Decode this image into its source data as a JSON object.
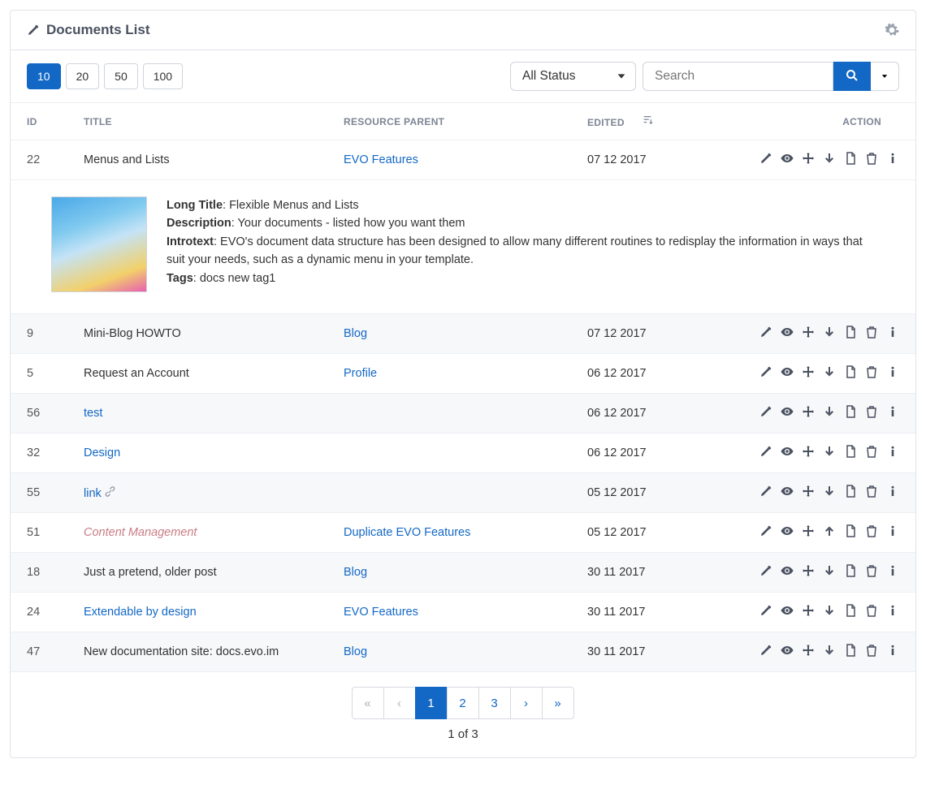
{
  "header": {
    "title": "Documents List"
  },
  "toolbar": {
    "page_sizes": [
      "10",
      "20",
      "50",
      "100"
    ],
    "active_size": "10",
    "status_label": "All Status",
    "search_placeholder": "Search"
  },
  "columns": {
    "id": "ID",
    "title": "TITLE",
    "parent": "RESOURCE PARENT",
    "edited": "EDITED",
    "action": "ACTION"
  },
  "rows": [
    {
      "id": "22",
      "title": "Menus and Lists",
      "title_link": false,
      "italic": false,
      "parent": "EVO Features",
      "parent_link": true,
      "edited": "07 12 2017",
      "arrow": "down",
      "chain": false,
      "expanded": true
    },
    {
      "id": "9",
      "title": "Mini-Blog HOWTO",
      "title_link": false,
      "italic": false,
      "parent": "Blog",
      "parent_link": true,
      "edited": "07 12 2017",
      "arrow": "down",
      "chain": false
    },
    {
      "id": "5",
      "title": "Request an Account",
      "title_link": false,
      "italic": false,
      "parent": "Profile",
      "parent_link": true,
      "edited": "06 12 2017",
      "arrow": "down",
      "chain": false
    },
    {
      "id": "56",
      "title": "test",
      "title_link": true,
      "italic": false,
      "parent": "",
      "parent_link": false,
      "edited": "06 12 2017",
      "arrow": "down",
      "chain": false
    },
    {
      "id": "32",
      "title": "Design",
      "title_link": true,
      "italic": false,
      "parent": "",
      "parent_link": false,
      "edited": "06 12 2017",
      "arrow": "down",
      "chain": false
    },
    {
      "id": "55",
      "title": "link",
      "title_link": true,
      "italic": false,
      "parent": "",
      "parent_link": false,
      "edited": "05 12 2017",
      "arrow": "down",
      "chain": true
    },
    {
      "id": "51",
      "title": "Content Management",
      "title_link": false,
      "italic": true,
      "parent": "Duplicate EVO Features",
      "parent_link": true,
      "edited": "05 12 2017",
      "arrow": "up",
      "chain": false
    },
    {
      "id": "18",
      "title": "Just a pretend, older post",
      "title_link": false,
      "italic": false,
      "parent": "Blog",
      "parent_link": true,
      "edited": "30 11 2017",
      "arrow": "down",
      "chain": false
    },
    {
      "id": "24",
      "title": "Extendable by design",
      "title_link": true,
      "italic": false,
      "parent": "EVO Features",
      "parent_link": true,
      "edited": "30 11 2017",
      "arrow": "down",
      "chain": false
    },
    {
      "id": "47",
      "title": "New documentation site: docs.evo.im",
      "title_link": false,
      "italic": false,
      "parent": "Blog",
      "parent_link": true,
      "edited": "30 11 2017",
      "arrow": "down",
      "chain": false
    }
  ],
  "detail": {
    "long_title_label": "Long Title",
    "long_title_value": ": Flexible Menus and Lists",
    "description_label": "Description",
    "description_value": ": Your documents - listed how you want them",
    "introtext_label": "Introtext",
    "introtext_value": ": EVO's document data structure has been designed to allow many different routines to redisplay the information in ways that suit your needs, such as a dynamic menu in your template.",
    "tags_label": "Tags",
    "tags_value": ": docs new tag1"
  },
  "pager": {
    "pages": [
      "1",
      "2",
      "3"
    ],
    "active": "1",
    "summary": "1 of 3"
  }
}
